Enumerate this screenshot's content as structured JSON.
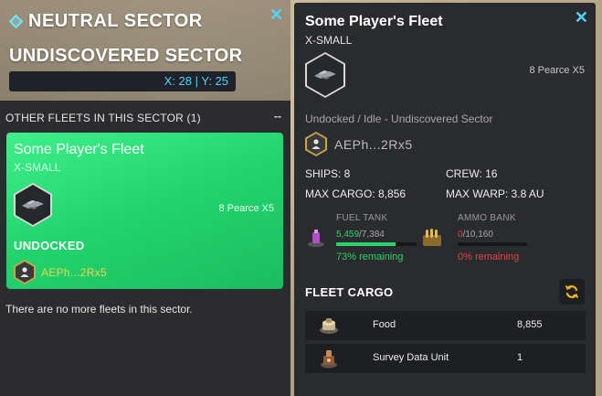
{
  "colors": {
    "accent_cyan": "#4fd6ff",
    "card_green": "#22d36d",
    "owner_gold": "#f6d34a",
    "fuel_green": "#2bd46a",
    "ammo_red": "#e04545"
  },
  "sector": {
    "title": "NEUTRAL SECTOR",
    "subtitle": "UNDISCOVERED SECTOR",
    "coords": "X: 28 | Y: 25",
    "close_icon": "close-icon"
  },
  "other_fleets": {
    "label": "OTHER FLEETS IN THIS SECTOR (1)",
    "collapse": "--",
    "empty_message": "There are no more fleets in this sector."
  },
  "fleet_card": {
    "name": "Some Player's Fleet",
    "size": "X-SMALL",
    "ship_count": "8 Pearce X5",
    "status": "UNDOCKED",
    "owner": "AEPh...2Rx5"
  },
  "fleet_detail": {
    "name": "Some Player's Fleet",
    "size": "X-SMALL",
    "ship_count": "8 Pearce X5",
    "status": "Undocked / Idle - Undiscovered Sector",
    "owner": "AEPh...2Rx5",
    "stats": {
      "ships": "SHIPS: 8",
      "crew": "CREW: 16",
      "max_cargo": "MAX CARGO: 8,856",
      "max_warp": "MAX WARP: 3.8 AU"
    },
    "fuel": {
      "label": "FUEL TANK",
      "current": "5,459",
      "max": "/7,384",
      "fill": 0.739,
      "remaining": "73% remaining"
    },
    "ammo": {
      "label": "AMMO BANK",
      "current": "0",
      "max": "/10,160",
      "fill": 0.0,
      "remaining": "0% remaining"
    },
    "cargo": {
      "title": "FLEET CARGO",
      "refresh_icon": "refresh-icon",
      "items": [
        {
          "name": "Food",
          "qty": "8,855",
          "icon": "food-icon"
        },
        {
          "name": "Survey Data Unit",
          "qty": "1",
          "icon": "survey-data-unit-icon"
        }
      ]
    }
  }
}
